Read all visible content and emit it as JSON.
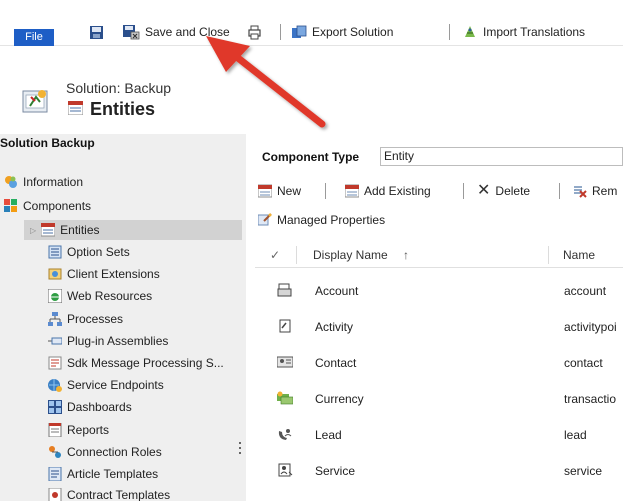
{
  "ribbon": {
    "file": "File",
    "save_close": "Save and Close",
    "export": "Export Solution",
    "import": "Import Translations"
  },
  "header": {
    "solution": "Solution: Backup",
    "title": "Entities"
  },
  "nav": {
    "title": "Solution Backup",
    "items": [
      {
        "label": "Information",
        "icon": "information-icon"
      },
      {
        "label": "Components",
        "icon": "components-icon"
      },
      {
        "label": "Entities",
        "icon": "entities-icon"
      },
      {
        "label": "Option Sets",
        "icon": "option-sets-icon"
      },
      {
        "label": "Client Extensions",
        "icon": "client-extensions-icon"
      },
      {
        "label": "Web Resources",
        "icon": "web-resources-icon"
      },
      {
        "label": "Processes",
        "icon": "processes-icon"
      },
      {
        "label": "Plug-in Assemblies",
        "icon": "plugin-icon"
      },
      {
        "label": "Sdk Message Processing S...",
        "icon": "sdk-icon"
      },
      {
        "label": "Service Endpoints",
        "icon": "service-endpoints-icon"
      },
      {
        "label": "Dashboards",
        "icon": "dashboards-icon"
      },
      {
        "label": "Reports",
        "icon": "reports-icon"
      },
      {
        "label": "Connection Roles",
        "icon": "connection-roles-icon"
      },
      {
        "label": "Article Templates",
        "icon": "article-templates-icon"
      },
      {
        "label": "Contract Templates",
        "icon": "contract-templates-icon"
      }
    ]
  },
  "main": {
    "component_type_label": "Component Type",
    "component_type_value": "Entity",
    "cmd_new": "New",
    "cmd_add_existing": "Add Existing",
    "cmd_delete": "Delete",
    "cmd_remove": "Rem",
    "cmd_managed": "Managed Properties",
    "col_display": "Display Name",
    "col_name": "Name",
    "sort_glyph": "↑",
    "check_glyph": "✓",
    "rows": [
      {
        "display": "Account",
        "name": "account",
        "icon": "account-icon"
      },
      {
        "display": "Activity",
        "name": "activitypoi",
        "icon": "activity-icon"
      },
      {
        "display": "Contact",
        "name": "contact",
        "icon": "contact-icon"
      },
      {
        "display": "Currency",
        "name": "transactio",
        "icon": "currency-icon"
      },
      {
        "display": "Lead",
        "name": "lead",
        "icon": "lead-icon"
      },
      {
        "display": "Service",
        "name": "service",
        "icon": "service-icon"
      }
    ]
  },
  "colors": {
    "file_blue": "#1e5ec6",
    "arrow_red": "#e0392b",
    "nav_bg": "#efefef",
    "nav_selected": "#d2d2d2"
  }
}
